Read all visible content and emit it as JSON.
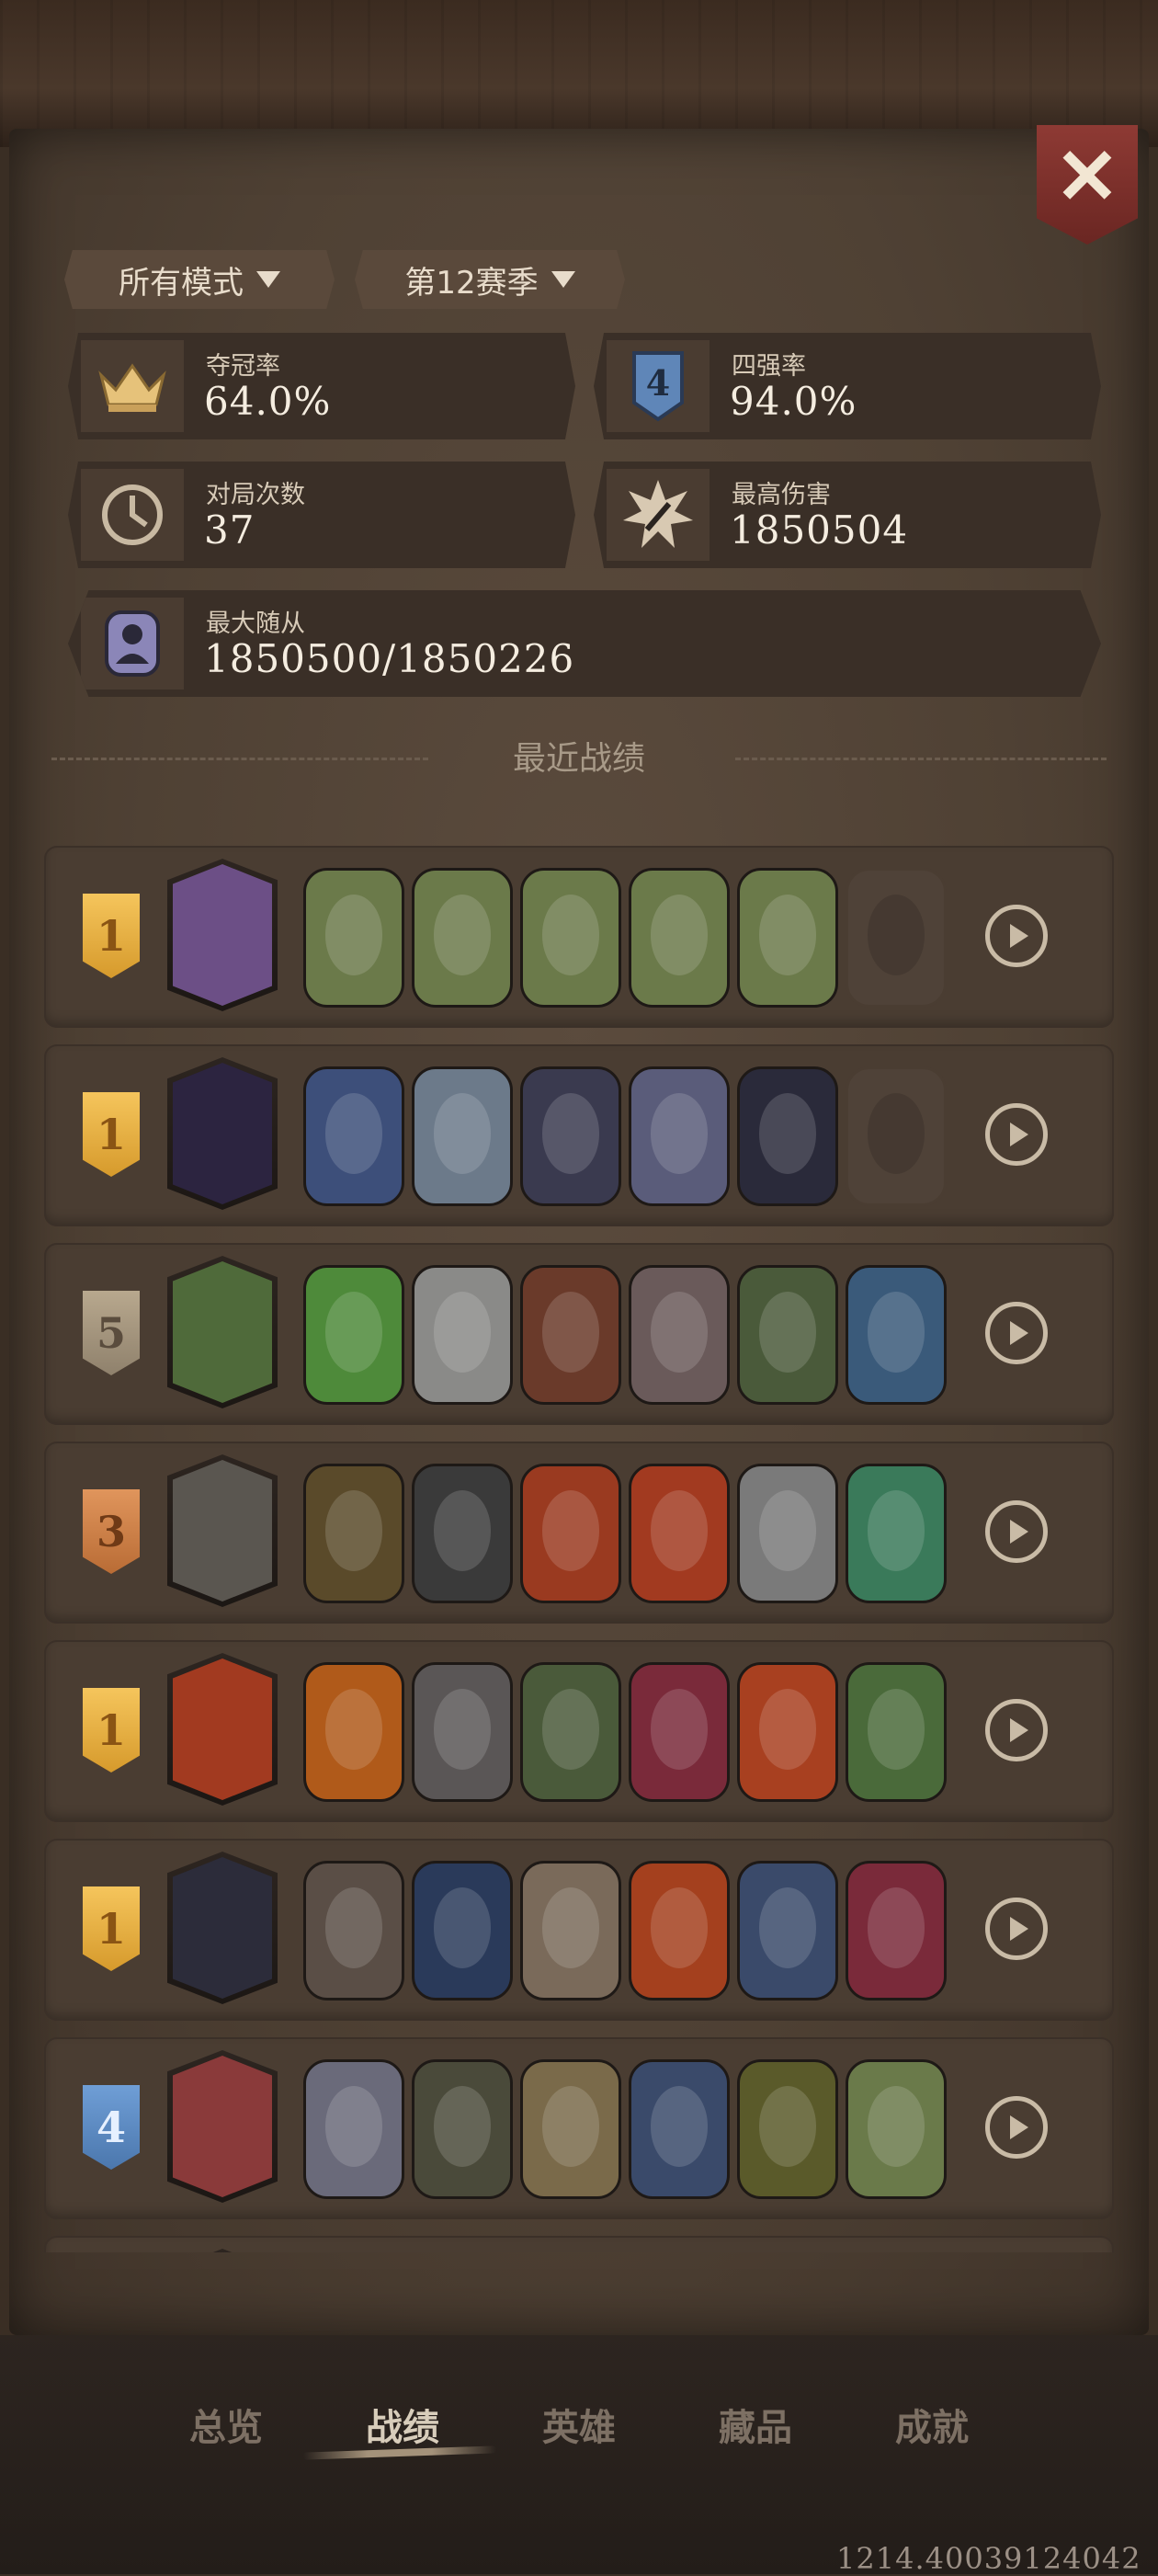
{
  "filters": {
    "mode": "所有模式",
    "season": "第12赛季"
  },
  "stats": {
    "win_rate_label": "夺冠率",
    "win_rate": "64.0%",
    "top4_label": "四强率",
    "top4": "94.0%",
    "games_label": "对局次数",
    "games": "37",
    "max_damage_label": "最高伤害",
    "max_damage": "1850504",
    "max_minion_label": "最大随从",
    "max_minion": "1850500/1850226",
    "top4_badge_text": "4"
  },
  "section_title": "最近战绩",
  "matches": [
    {
      "rank": "1",
      "tier": "gold",
      "hero_color": "#6c4f86",
      "cards": [
        "#6b7a4a",
        "#6b7a4a",
        "#6b7a4a",
        "#6b7a4a",
        "#6b7a4a",
        "empty"
      ]
    },
    {
      "rank": "1",
      "tier": "gold",
      "hero_color": "#2c2440",
      "cards": [
        "#3d4f7a",
        "#6c7a8a",
        "#3a3a4f",
        "#5a5c7a",
        "#2a2a3a",
        "empty"
      ]
    },
    {
      "rank": "5",
      "tier": "gray",
      "hero_color": "#4f6a3a",
      "cards": [
        "#4e8a3a",
        "#8a8a88",
        "#6a3a2a",
        "#6a5a5a",
        "#4a5a3a",
        "#3a5a7a"
      ]
    },
    {
      "rank": "3",
      "tier": "copper",
      "hero_color": "#5a5650",
      "cards": [
        "#5a4a2a",
        "#3a3a3a",
        "#9a3a20",
        "#a23a20",
        "#7a7a7a",
        "#3a7a5a"
      ]
    },
    {
      "rank": "1",
      "tier": "gold",
      "hero_color": "#a23a20",
      "cards": [
        "#b05a1a",
        "#5a5656",
        "#4a5a3a",
        "#7a2a3a",
        "#a84020",
        "#4a6a3a"
      ]
    },
    {
      "rank": "1",
      "tier": "gold",
      "hero_color": "#2c2c3a",
      "cards": [
        "#5a4e46",
        "#2a3a5a",
        "#7a6a5a",
        "#a4401e",
        "#3a4a6a",
        "#7a2a3a"
      ]
    },
    {
      "rank": "4",
      "tier": "blue",
      "hero_color": "#8a3a3a",
      "cards": [
        "#6a6a7a",
        "#4a4a3a",
        "#7a6a4a",
        "#3a4a6a",
        "#5a5a2a",
        "#6a7a4a"
      ]
    },
    {
      "rank": "",
      "tier": "gray",
      "hero_color": "#4a3d32",
      "cards": []
    }
  ],
  "tabs": [
    "总览",
    "战绩",
    "英雄",
    "藏品",
    "成就"
  ],
  "active_tab": "战绩",
  "footer_id": "1214.40039124042"
}
